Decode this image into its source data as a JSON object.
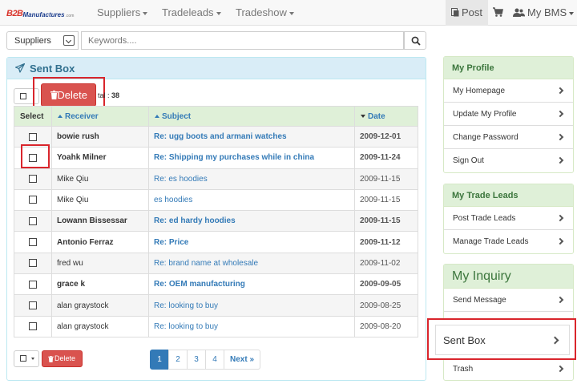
{
  "nav": {
    "logo_b2b": "B2B",
    "logo_rest": "Manufactures",
    "logo_tld": ".com",
    "items": [
      {
        "label": "Suppliers"
      },
      {
        "label": "Tradeleads"
      },
      {
        "label": "Tradeshow"
      }
    ],
    "post_label": "Post",
    "bms_label": "My BMS"
  },
  "search": {
    "category": "Suppliers",
    "placeholder": "Keywords....",
    "value": ""
  },
  "panel": {
    "title": "Sent Box",
    "delete_label": "Delete",
    "total_prefix": "tal :",
    "total_count": "38"
  },
  "table": {
    "headers": {
      "select": "Select",
      "receiver": "Receiver",
      "subject": "Subject",
      "date": "Date"
    },
    "rows": [
      {
        "receiver": "bowie rush",
        "subject": "Re: ugg boots and armani watches",
        "date": "2009-12-01"
      },
      {
        "receiver": "Yoahk Milner",
        "subject": "Re: Shipping my purchases while in china",
        "date": "2009-11-24"
      },
      {
        "receiver": "Mike Qiu",
        "subject": "Re: es hoodies",
        "date": "2009-11-15"
      },
      {
        "receiver": "Mike Qiu",
        "subject": "es hoodies",
        "date": "2009-11-15"
      },
      {
        "receiver": "Lowann Bissessar",
        "subject": "Re: ed hardy hoodies",
        "date": "2009-11-15"
      },
      {
        "receiver": "Antonio Ferraz",
        "subject": "Re: Price",
        "date": "2009-11-12"
      },
      {
        "receiver": "fred wu",
        "subject": "Re: brand name at wholesale",
        "date": "2009-11-02"
      },
      {
        "receiver": "grace k",
        "subject": "Re: OEM manufacturing",
        "date": "2009-09-05"
      },
      {
        "receiver": "alan graystock",
        "subject": "Re: looking to buy",
        "date": "2009-08-25"
      },
      {
        "receiver": "alan graystock",
        "subject": "Re: looking to buy",
        "date": "2009-08-20"
      }
    ]
  },
  "footer": {
    "delete_label": "Delete",
    "pages": [
      "1",
      "2",
      "3",
      "4"
    ],
    "next_label": "Next »",
    "active_page": "1"
  },
  "sidebar": {
    "profile": {
      "title": "My Profile",
      "items": [
        {
          "label": "My Homepage"
        },
        {
          "label": "Update My Profile"
        },
        {
          "label": "Change Password"
        },
        {
          "label": "Sign Out"
        }
      ]
    },
    "trade": {
      "title": "My Trade Leads",
      "items": [
        {
          "label": "Post Trade Leads"
        },
        {
          "label": "Manage Trade Leads"
        }
      ]
    },
    "inquiry": {
      "title": "My Inquiry",
      "items": [
        {
          "label": "Send Message"
        },
        {
          "label": "Sent Box"
        },
        {
          "label": "Trash"
        }
      ]
    }
  },
  "colors": {
    "accent": "#337ab7",
    "danger": "#d9534f",
    "highlight": "#d9252c",
    "info_header": "#d9edf7",
    "success_header": "#dff0d8"
  }
}
